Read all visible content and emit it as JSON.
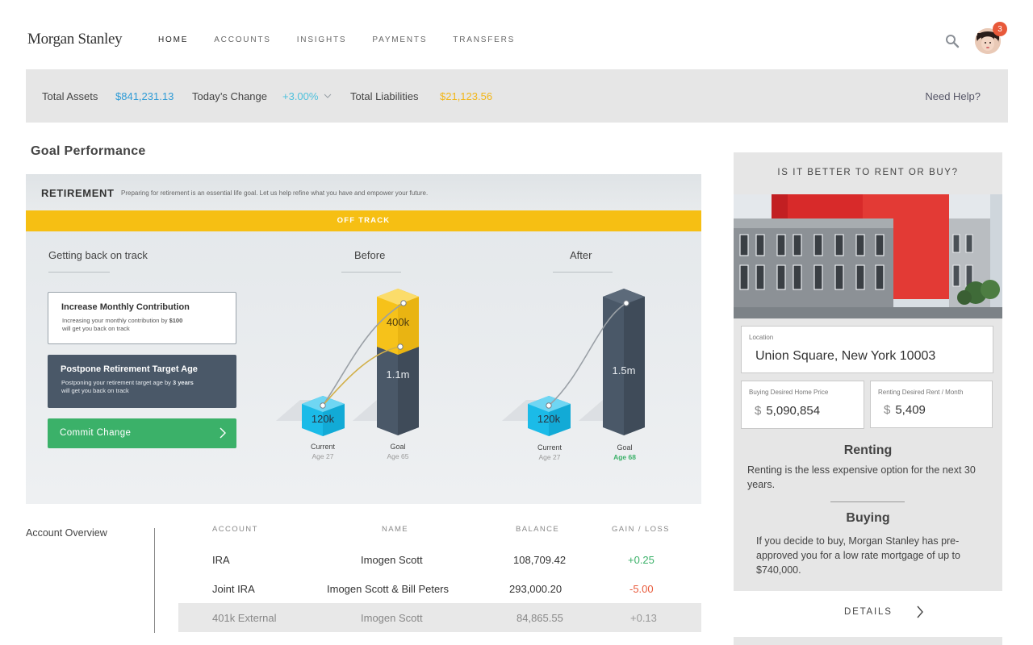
{
  "header": {
    "logo": "Morgan Stanley",
    "nav": [
      "HOME",
      "ACCOUNTS",
      "INSIGHTS",
      "PAYMENTS",
      "TRANSFERS"
    ],
    "notification_count": "3"
  },
  "summary": {
    "total_assets_label": "Total Assets",
    "total_assets_value": "$841,231.13",
    "todays_change_label": "Today’s Change",
    "todays_change_value": "+3.00%",
    "total_liabilities_label": "Total Liabilities",
    "total_liabilities_value": "$21,123.56",
    "help": "Need Help?"
  },
  "goal": {
    "section_title": "Goal Performance",
    "card_title": "RETIREMENT",
    "card_desc": "Preparing for retirement is an essential life goal. Let us help refine what you have and empower your future.",
    "status": "OFF TRACK",
    "col_options": "Getting back on track",
    "col_before": "Before",
    "col_after": "After",
    "option1_title": "Increase Monthly Contribution",
    "option1_text_a": "Increasing your monthly contribution by ",
    "option1_text_b": "$100",
    "option1_text_c": "will get you back on track",
    "option2_title": "Postpone Retirement Target Age",
    "option2_text_a": "Postponing your retirement target age by ",
    "option2_text_b": "3 years",
    "option2_text_c": "will get you back on track",
    "commit": "Commit Change",
    "before": {
      "current_value": "120k",
      "goal_value": "1.1m",
      "goal_extra": "400k",
      "current_label": "Current",
      "current_age": "Age 27",
      "goal_label": "Goal",
      "goal_age": "Age 65"
    },
    "after": {
      "current_value": "120k",
      "goal_value": "1.5m",
      "current_label": "Current",
      "current_age": "Age 27",
      "goal_label": "Goal",
      "goal_age": "Age 68"
    }
  },
  "accounts": {
    "title": "Account Overview",
    "headers": [
      "ACCOUNT",
      "NAME",
      "BALANCE",
      "GAIN / LOSS"
    ],
    "rows": [
      {
        "account": "IRA",
        "name": "Imogen Scott",
        "balance": "108,709.42",
        "gain": "+0.25"
      },
      {
        "account": "Joint IRA",
        "name": "Imogen Scott & Bill Peters",
        "balance": "293,000.20",
        "gain": "-5.00"
      },
      {
        "account": "401k External",
        "name": "Imogen Scott",
        "balance": "84,865.55",
        "gain": "+0.13"
      }
    ]
  },
  "rent_buy": {
    "title": "IS IT BETTER TO RENT OR BUY?",
    "location_label": "Location",
    "location_value": "Union Square, New York 10003",
    "buy_price_label": "Buying Desired Home Price",
    "buy_price_value": "5,090,854",
    "rent_label": "Renting Desired Rent / Month",
    "rent_value": "5,409",
    "currency": "$",
    "renting_title": "Renting",
    "renting_text": "Renting is the less expensive option for the next 30 years.",
    "buying_title": "Buying",
    "buying_text": "If you decide to buy, Morgan Stanley has pre-approved you for a low rate mortgage of up to $740,000.",
    "details": "DETAILS"
  },
  "colors": {
    "accent_green": "#3bb169",
    "accent_yellow": "#f6bf13",
    "accent_blue": "#2f9bd6",
    "cyan": "#1bbbe8",
    "slate": "#4a5868",
    "alert": "#e8593a"
  }
}
